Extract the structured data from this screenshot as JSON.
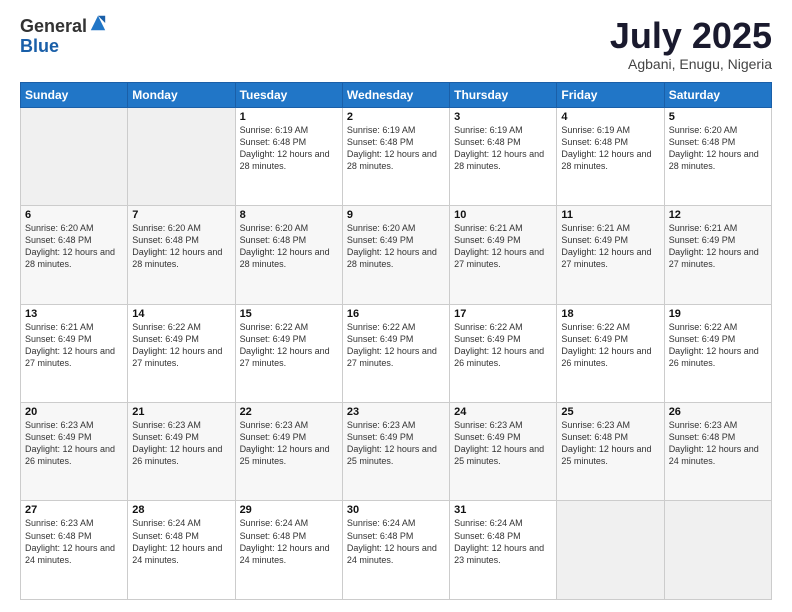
{
  "header": {
    "logo_general": "General",
    "logo_blue": "Blue",
    "title_month": "July 2025",
    "title_location": "Agbani, Enugu, Nigeria"
  },
  "weekdays": [
    "Sunday",
    "Monday",
    "Tuesday",
    "Wednesday",
    "Thursday",
    "Friday",
    "Saturday"
  ],
  "weeks": [
    [
      {
        "day": "",
        "empty": true
      },
      {
        "day": "",
        "empty": true
      },
      {
        "day": "1",
        "sunrise": "6:19 AM",
        "sunset": "6:48 PM",
        "daylight": "12 hours and 28 minutes."
      },
      {
        "day": "2",
        "sunrise": "6:19 AM",
        "sunset": "6:48 PM",
        "daylight": "12 hours and 28 minutes."
      },
      {
        "day": "3",
        "sunrise": "6:19 AM",
        "sunset": "6:48 PM",
        "daylight": "12 hours and 28 minutes."
      },
      {
        "day": "4",
        "sunrise": "6:19 AM",
        "sunset": "6:48 PM",
        "daylight": "12 hours and 28 minutes."
      },
      {
        "day": "5",
        "sunrise": "6:20 AM",
        "sunset": "6:48 PM",
        "daylight": "12 hours and 28 minutes."
      }
    ],
    [
      {
        "day": "6",
        "sunrise": "6:20 AM",
        "sunset": "6:48 PM",
        "daylight": "12 hours and 28 minutes."
      },
      {
        "day": "7",
        "sunrise": "6:20 AM",
        "sunset": "6:48 PM",
        "daylight": "12 hours and 28 minutes."
      },
      {
        "day": "8",
        "sunrise": "6:20 AM",
        "sunset": "6:48 PM",
        "daylight": "12 hours and 28 minutes."
      },
      {
        "day": "9",
        "sunrise": "6:20 AM",
        "sunset": "6:49 PM",
        "daylight": "12 hours and 28 minutes."
      },
      {
        "day": "10",
        "sunrise": "6:21 AM",
        "sunset": "6:49 PM",
        "daylight": "12 hours and 27 minutes."
      },
      {
        "day": "11",
        "sunrise": "6:21 AM",
        "sunset": "6:49 PM",
        "daylight": "12 hours and 27 minutes."
      },
      {
        "day": "12",
        "sunrise": "6:21 AM",
        "sunset": "6:49 PM",
        "daylight": "12 hours and 27 minutes."
      }
    ],
    [
      {
        "day": "13",
        "sunrise": "6:21 AM",
        "sunset": "6:49 PM",
        "daylight": "12 hours and 27 minutes."
      },
      {
        "day": "14",
        "sunrise": "6:22 AM",
        "sunset": "6:49 PM",
        "daylight": "12 hours and 27 minutes."
      },
      {
        "day": "15",
        "sunrise": "6:22 AM",
        "sunset": "6:49 PM",
        "daylight": "12 hours and 27 minutes."
      },
      {
        "day": "16",
        "sunrise": "6:22 AM",
        "sunset": "6:49 PM",
        "daylight": "12 hours and 27 minutes."
      },
      {
        "day": "17",
        "sunrise": "6:22 AM",
        "sunset": "6:49 PM",
        "daylight": "12 hours and 26 minutes."
      },
      {
        "day": "18",
        "sunrise": "6:22 AM",
        "sunset": "6:49 PM",
        "daylight": "12 hours and 26 minutes."
      },
      {
        "day": "19",
        "sunrise": "6:22 AM",
        "sunset": "6:49 PM",
        "daylight": "12 hours and 26 minutes."
      }
    ],
    [
      {
        "day": "20",
        "sunrise": "6:23 AM",
        "sunset": "6:49 PM",
        "daylight": "12 hours and 26 minutes."
      },
      {
        "day": "21",
        "sunrise": "6:23 AM",
        "sunset": "6:49 PM",
        "daylight": "12 hours and 26 minutes."
      },
      {
        "day": "22",
        "sunrise": "6:23 AM",
        "sunset": "6:49 PM",
        "daylight": "12 hours and 25 minutes."
      },
      {
        "day": "23",
        "sunrise": "6:23 AM",
        "sunset": "6:49 PM",
        "daylight": "12 hours and 25 minutes."
      },
      {
        "day": "24",
        "sunrise": "6:23 AM",
        "sunset": "6:49 PM",
        "daylight": "12 hours and 25 minutes."
      },
      {
        "day": "25",
        "sunrise": "6:23 AM",
        "sunset": "6:48 PM",
        "daylight": "12 hours and 25 minutes."
      },
      {
        "day": "26",
        "sunrise": "6:23 AM",
        "sunset": "6:48 PM",
        "daylight": "12 hours and 24 minutes."
      }
    ],
    [
      {
        "day": "27",
        "sunrise": "6:23 AM",
        "sunset": "6:48 PM",
        "daylight": "12 hours and 24 minutes."
      },
      {
        "day": "28",
        "sunrise": "6:24 AM",
        "sunset": "6:48 PM",
        "daylight": "12 hours and 24 minutes."
      },
      {
        "day": "29",
        "sunrise": "6:24 AM",
        "sunset": "6:48 PM",
        "daylight": "12 hours and 24 minutes."
      },
      {
        "day": "30",
        "sunrise": "6:24 AM",
        "sunset": "6:48 PM",
        "daylight": "12 hours and 24 minutes."
      },
      {
        "day": "31",
        "sunrise": "6:24 AM",
        "sunset": "6:48 PM",
        "daylight": "12 hours and 23 minutes."
      },
      {
        "day": "",
        "empty": true
      },
      {
        "day": "",
        "empty": true
      }
    ]
  ],
  "labels": {
    "sunrise_prefix": "Sunrise: ",
    "sunset_prefix": "Sunset: ",
    "daylight_prefix": "Daylight: "
  }
}
